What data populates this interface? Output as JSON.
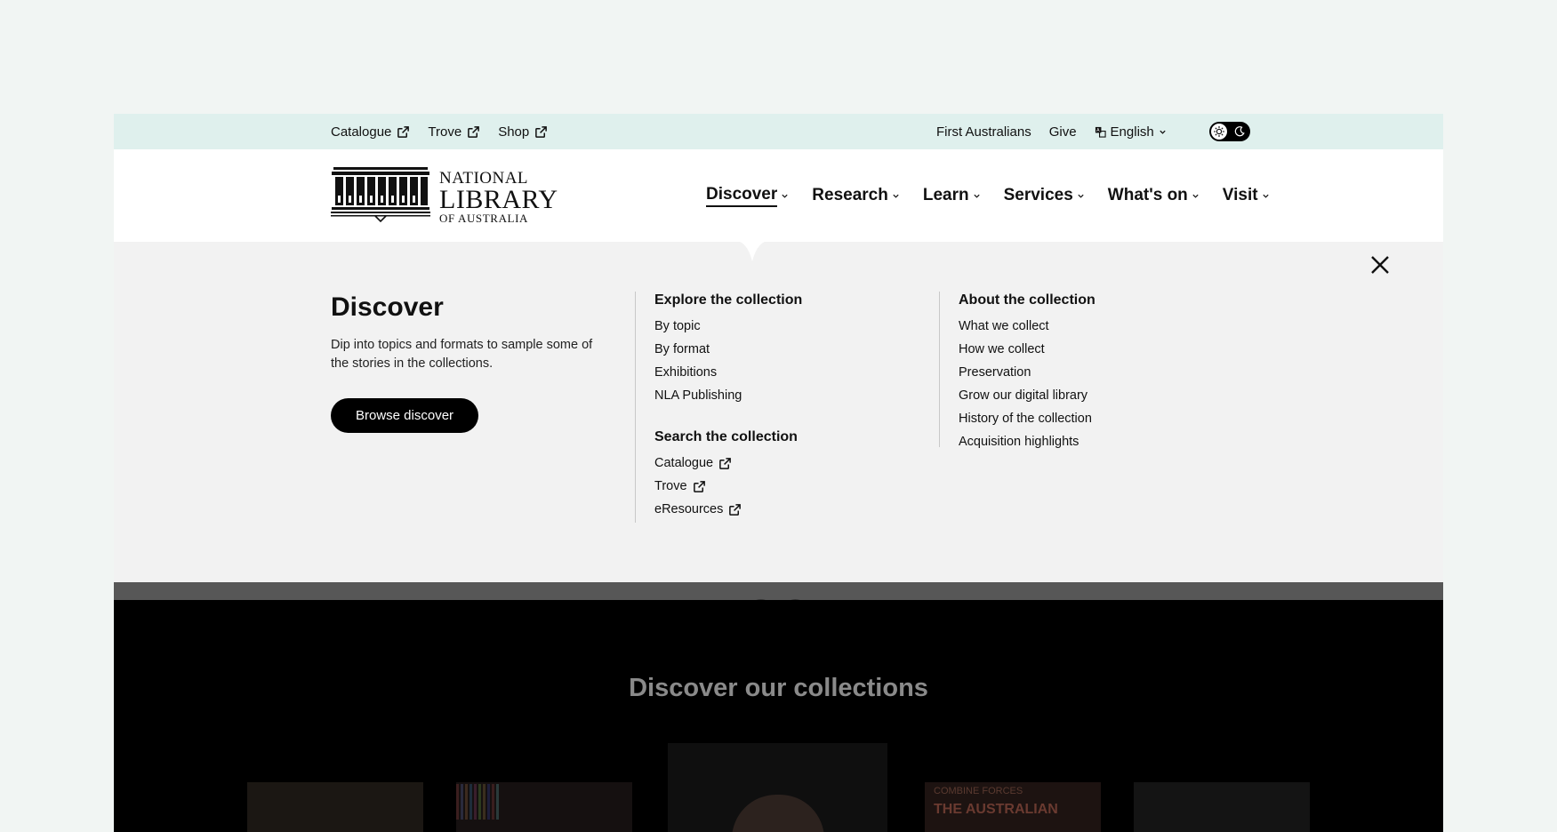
{
  "utility": {
    "left_links": [
      {
        "label": "Catalogue",
        "external": true
      },
      {
        "label": "Trove",
        "external": true
      },
      {
        "label": "Shop",
        "external": true
      }
    ],
    "right_links": [
      {
        "label": "First Australians"
      },
      {
        "label": "Give"
      }
    ],
    "language": "English"
  },
  "logo": {
    "line1": "NATIONAL",
    "line2": "LIBRARY",
    "line3": "OF AUSTRALIA"
  },
  "nav": {
    "items": [
      {
        "label": "Discover",
        "active": true
      },
      {
        "label": "Research"
      },
      {
        "label": "Learn"
      },
      {
        "label": "Services"
      },
      {
        "label": "What's on"
      },
      {
        "label": "Visit"
      }
    ]
  },
  "mega": {
    "title": "Discover",
    "description": "Dip into topics and formats to sample some of the stories in the collections.",
    "button_label": "Browse discover",
    "explore": {
      "heading": "Explore the collection",
      "items": [
        "By topic",
        "By format",
        "Exhibitions",
        "NLA Publishing"
      ]
    },
    "search": {
      "heading": "Search the collection",
      "items": [
        "Catalogue",
        "Trove",
        "eResources"
      ]
    },
    "about": {
      "heading": "About the collection",
      "items": [
        "What we collect",
        "How we collect",
        "Preservation",
        "Grow our digital library",
        "History of the collection",
        "Acquisition highlights"
      ]
    }
  },
  "content": {
    "title": "Discover our collections",
    "poster_top": "COMBINE FORCES",
    "poster_main": "THE AUSTRALIAN"
  },
  "colors": {
    "utility_bg": "#dff0ed",
    "panel_bg": "#f2f2f2",
    "accent": "#000000"
  }
}
